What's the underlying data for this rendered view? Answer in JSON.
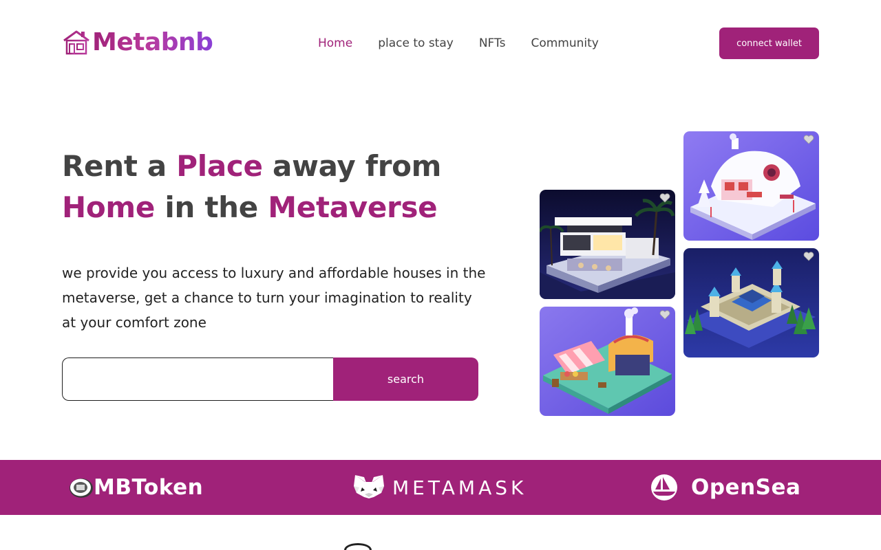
{
  "brand": {
    "name": "Metabnb",
    "logo_icon": "house-icon"
  },
  "nav": {
    "links": [
      {
        "label": "Home",
        "active": true
      },
      {
        "label": "place to stay",
        "active": false
      },
      {
        "label": "NFTs",
        "active": false
      },
      {
        "label": "Community",
        "active": false
      }
    ],
    "cta_label": "connect wallet"
  },
  "hero": {
    "title_parts": [
      "Rent a ",
      "Place",
      " away from",
      "Home",
      " in the ",
      "Metaverse"
    ],
    "description": "we provide you access to luxury and affordable houses in the metaverse, get a chance to turn your imagination to reality at your comfort zone",
    "search": {
      "value": "",
      "placeholder": "",
      "button_label": "search"
    }
  },
  "gallery": [
    {
      "name": "modern-villa",
      "icon": "heart-icon"
    },
    {
      "name": "snow-cottage",
      "icon": "heart-icon"
    },
    {
      "name": "castle",
      "icon": "heart-icon"
    },
    {
      "name": "market-stall",
      "icon": "heart-icon"
    }
  ],
  "partners": [
    {
      "label": "MBToken",
      "icon": "mbtoken-coin-icon"
    },
    {
      "label": "METAMASK",
      "icon": "metamask-fox-icon"
    },
    {
      "label": "OpenSea",
      "icon": "opensea-boat-icon"
    }
  ],
  "colors": {
    "accent": "#a02279",
    "text": "#434343",
    "gradient_end": "#8a3fd6"
  }
}
